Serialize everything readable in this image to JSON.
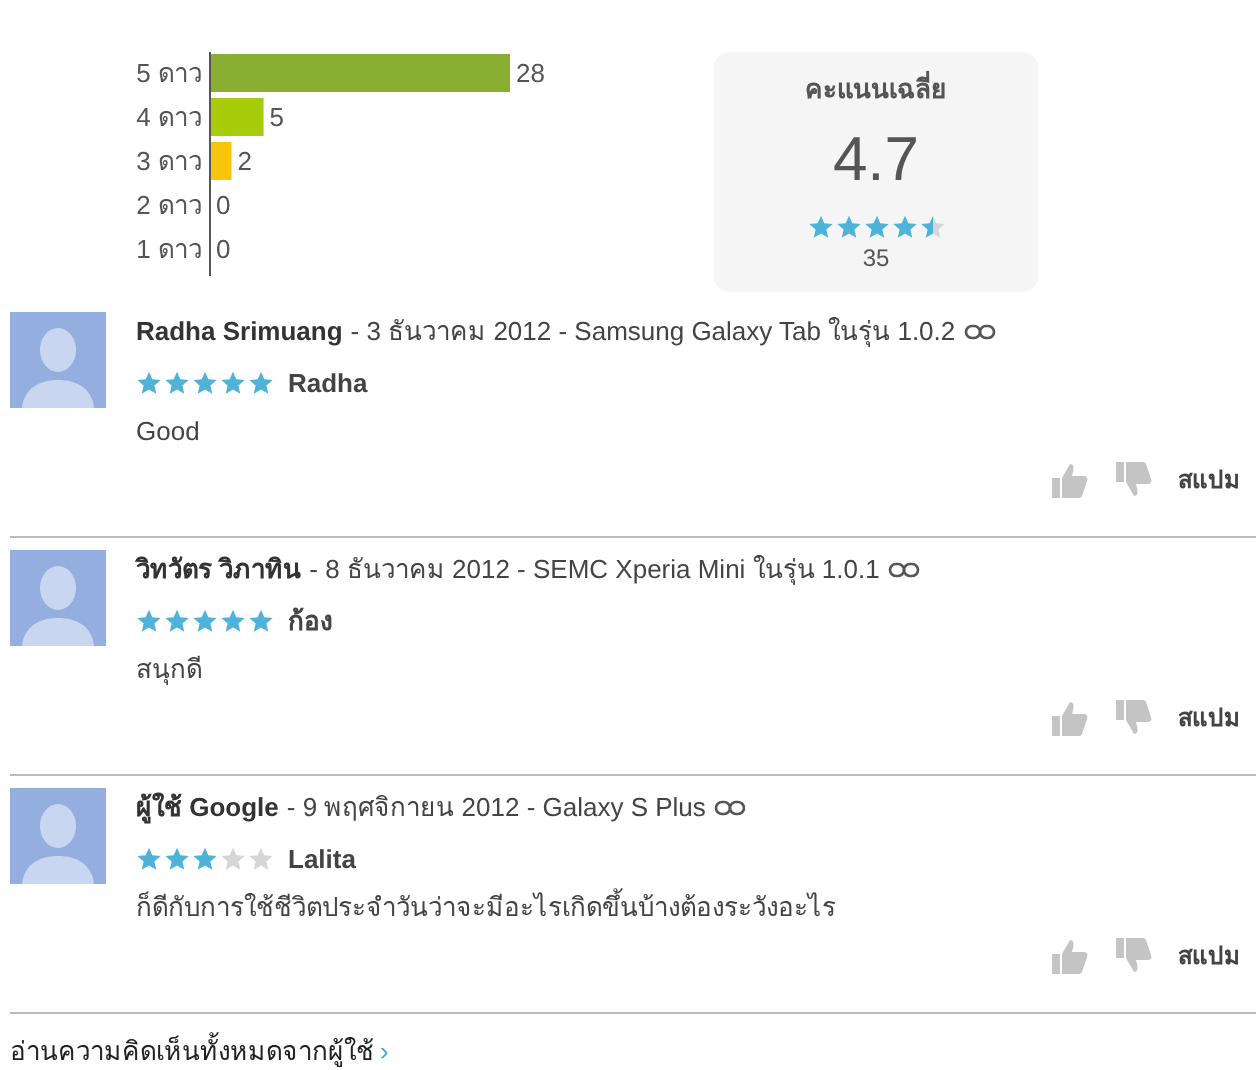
{
  "histogram": {
    "chart_data": {
      "type": "bar",
      "orientation": "horizontal",
      "categories": [
        "5 ดาว",
        "4 ดาว",
        "3 ดาว",
        "2 ดาว",
        "1 ดาว"
      ],
      "series": [
        {
          "values": [
            28,
            5,
            2,
            0,
            0
          ]
        }
      ],
      "colors": [
        "#8aae31",
        "#a8cb0a",
        "#f9c40c"
      ],
      "data_labels": true
    }
  },
  "average": {
    "title": "คะแนนเฉลี่ย",
    "score": "4.7",
    "stars": 4.5,
    "count": "35"
  },
  "reviews": [
    {
      "author": "Radha Srimuang",
      "meta": "- 3 ธันวาคม 2012 - Samsung Galaxy Tab ในรุ่น 1.0.2",
      "stars": 5,
      "title": "Radha",
      "body": "Good",
      "spam": "สแปม"
    },
    {
      "author": "วิทวัตร วิภาทิน",
      "meta": "- 8 ธันวาคม 2012 - SEMC Xperia Mini ในรุ่น 1.0.1",
      "stars": 5,
      "title": "ก้อง",
      "body": "สนุกดี",
      "spam": "สแปม"
    },
    {
      "author": "ผู้ใช้ Google",
      "meta": "- 9 พฤศจิกายน 2012 - Galaxy S Plus",
      "stars": 3,
      "title": "Lalita",
      "body": "ก็ดีกับการใช้ชีวิตประจำวันว่าจะมีอะไรเกิดขึ้นบ้างต้องระวังอะไร",
      "spam": "สแปม"
    }
  ],
  "read_all": {
    "label": "อ่านความคิดเห็นทั้งหมดจากผู้ใช้",
    "arrow": "›"
  }
}
